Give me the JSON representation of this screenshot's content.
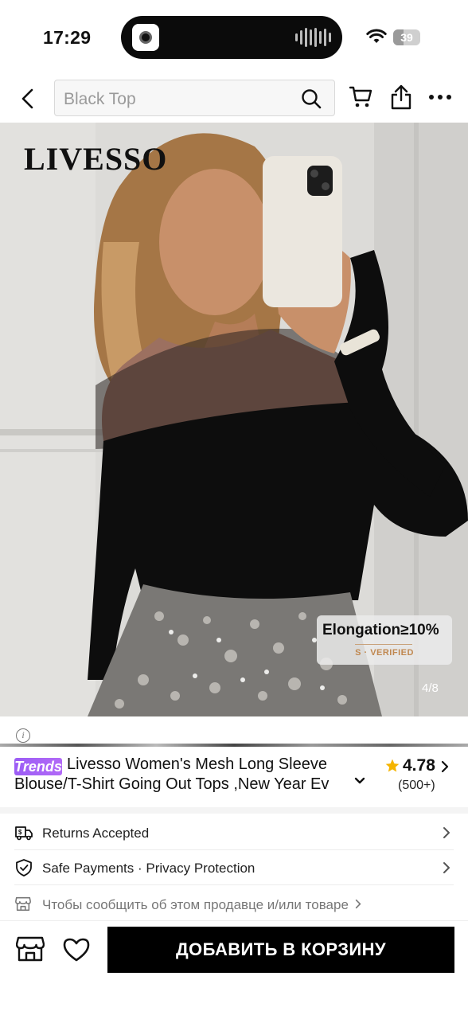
{
  "status_bar": {
    "time": "17:29",
    "battery": "39"
  },
  "search": {
    "placeholder": "Black Top"
  },
  "product": {
    "brand_logo": "LIVESSO",
    "image_counter": "4/8",
    "elongation_text": "Elongation≥10%",
    "verified_text": "S · VERIFIED",
    "trends_badge": "Trends",
    "title": "Livesso Women's Mesh Long Sleeve Blouse/T-Shirt Going Out Tops ,New Year Ev",
    "rating": "4.78",
    "rating_count": "(500+)"
  },
  "services": [
    {
      "label": "Returns Accepted",
      "icon": "truck-return-icon"
    },
    {
      "label": "Safe Payments · Privacy Protection",
      "icon": "shield-check-icon"
    },
    {
      "label": "Чтобы сообщить об этом продавце и/или товаре",
      "icon": "store-icon"
    }
  ],
  "bottom_bar": {
    "add_to_cart_label": "ДОБАВИТЬ В КОРЗИНУ"
  },
  "colors": {
    "trends_purple": "#9b5cf5",
    "star": "#f5b400",
    "primary_button": "#000000"
  }
}
